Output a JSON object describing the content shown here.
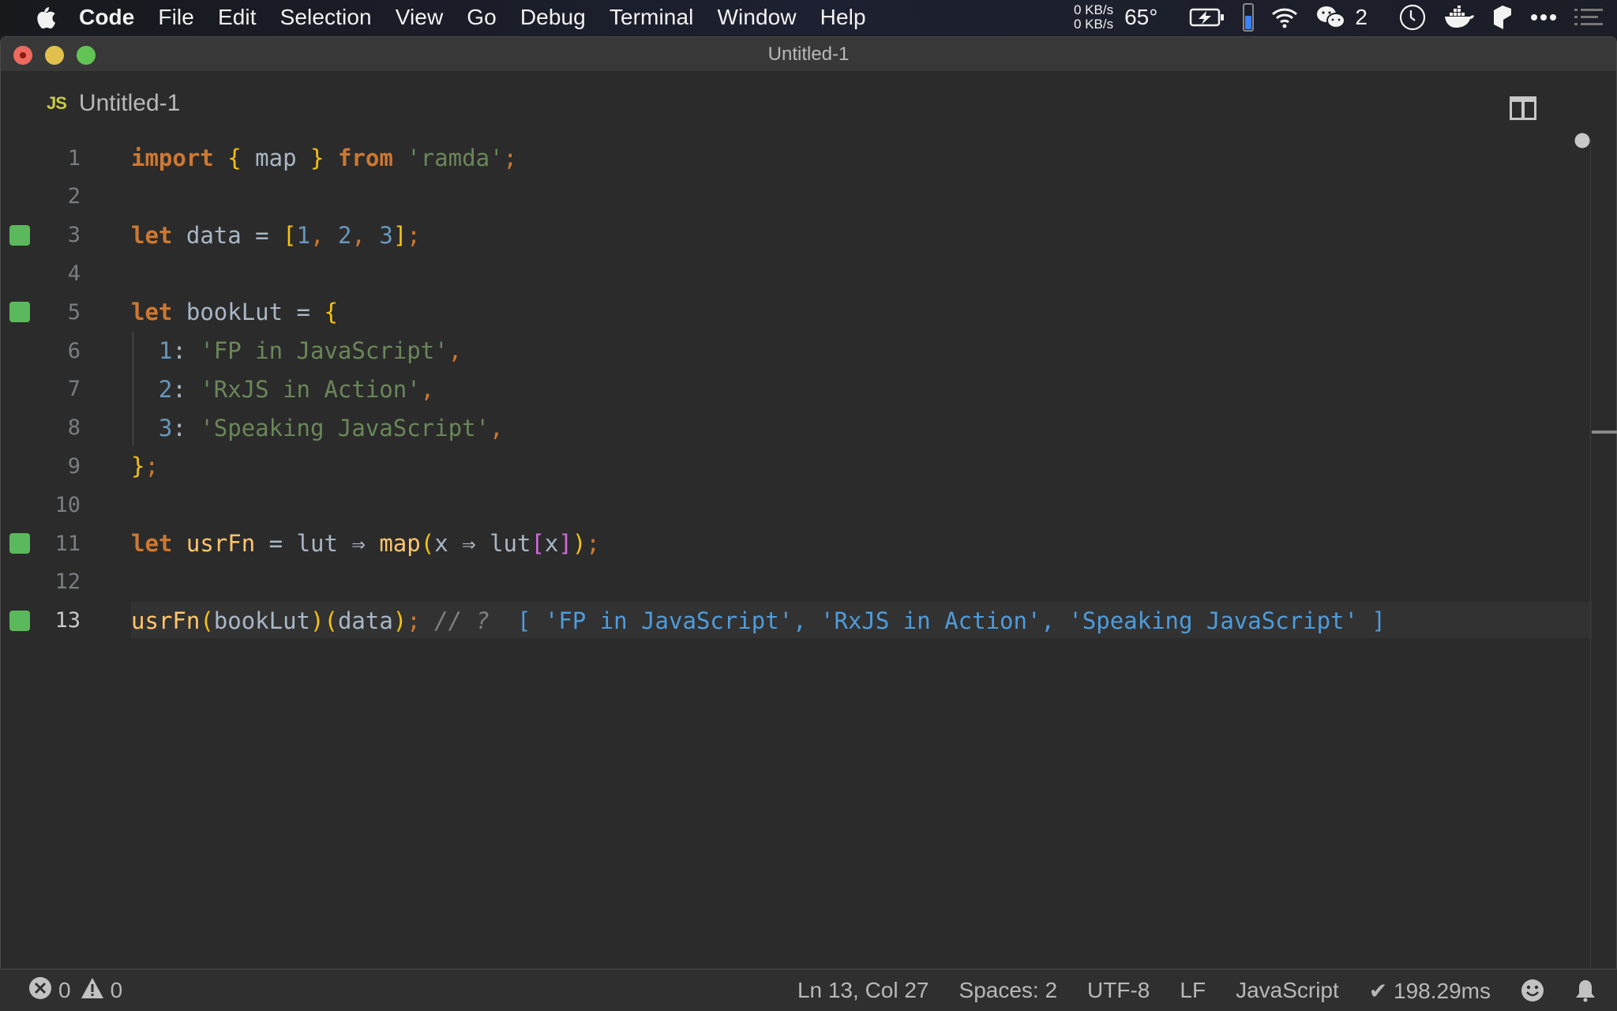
{
  "menubar": {
    "app_name": "Code",
    "items": [
      "File",
      "Edit",
      "Selection",
      "View",
      "Go",
      "Debug",
      "Terminal",
      "Window",
      "Help"
    ],
    "status": {
      "net_up": "0 KB/s",
      "net_down": "0 KB/s",
      "temperature": "65°",
      "wechat_count": "2",
      "icons": [
        "battery-charging-icon",
        "memory-gauge-icon",
        "wifi-icon",
        "wechat-icon",
        "clock-icon",
        "docker-icon",
        "app-icon",
        "more-icon",
        "notification-list-icon"
      ]
    }
  },
  "window": {
    "title": "Untitled-1",
    "tab": {
      "badge": "JS",
      "label": "Untitled-1"
    }
  },
  "editor": {
    "current_line": 13,
    "lines": [
      {
        "n": "1",
        "marked": false
      },
      {
        "n": "2",
        "marked": false
      },
      {
        "n": "3",
        "marked": true
      },
      {
        "n": "4",
        "marked": false
      },
      {
        "n": "5",
        "marked": true
      },
      {
        "n": "6",
        "marked": false
      },
      {
        "n": "7",
        "marked": false
      },
      {
        "n": "8",
        "marked": false
      },
      {
        "n": "9",
        "marked": false
      },
      {
        "n": "10",
        "marked": false
      },
      {
        "n": "11",
        "marked": true
      },
      {
        "n": "12",
        "marked": false
      },
      {
        "n": "13",
        "marked": true
      }
    ],
    "tokens": {
      "l1": {
        "import": "import",
        "lb": "{",
        "map": " map ",
        "rb": "}",
        "from": "from",
        "module": "'ramda'",
        "semi": ";"
      },
      "l3": {
        "let": "let",
        "name": "data",
        "eq": " = ",
        "lb": "[",
        "n1": "1",
        "c1": ", ",
        "n2": "2",
        "c2": ", ",
        "n3": "3",
        "rb": "]",
        "semi": ";"
      },
      "l5": {
        "let": "let",
        "name": "bookLut",
        "eq": " = ",
        "lb": "{"
      },
      "l6": {
        "key": "1",
        "colon": ": ",
        "val": "'FP in JavaScript'",
        "comma": ","
      },
      "l7": {
        "key": "2",
        "colon": ": ",
        "val": "'RxJS in Action'",
        "comma": ","
      },
      "l8": {
        "key": "3",
        "colon": ": ",
        "val": "'Speaking JavaScript'",
        "comma": ","
      },
      "l9": {
        "rb": "}",
        "semi": ";"
      },
      "l11": {
        "let": "let",
        "name": "usrFn",
        "eq": " = ",
        "param": "lut",
        "arrow1": " ⇒ ",
        "map": "map",
        "lp": "(",
        "x": "x",
        "arrow2": " ⇒ ",
        "lut": "lut",
        "lb": "[",
        "idx": "x",
        "rb": "]",
        "rp": ")",
        "semi": ";"
      },
      "l13": {
        "fn": "usrFn",
        "lp1": "(",
        "arg1": "bookLut",
        "rp1": ")",
        "lp2": "(",
        "arg2": "data",
        "rp2": ")",
        "semi": ";",
        "comment": " // ? ",
        "result": " [ 'FP in JavaScript', 'RxJS in Action', 'Speaking JavaScript' ]"
      }
    }
  },
  "statusbar": {
    "errors": "0",
    "warnings": "0",
    "cursor": "Ln 13, Col 27",
    "indent": "Spaces: 2",
    "encoding": "UTF-8",
    "eol": "LF",
    "language": "JavaScript",
    "timing": "✔ 198.29ms"
  },
  "colors": {
    "coverage_mark": "#5cb85c",
    "keyword": "#cc7832",
    "string": "#6a8759",
    "number": "#6897bb",
    "bracket": "#f5c211",
    "result": "#4f9cdb"
  }
}
